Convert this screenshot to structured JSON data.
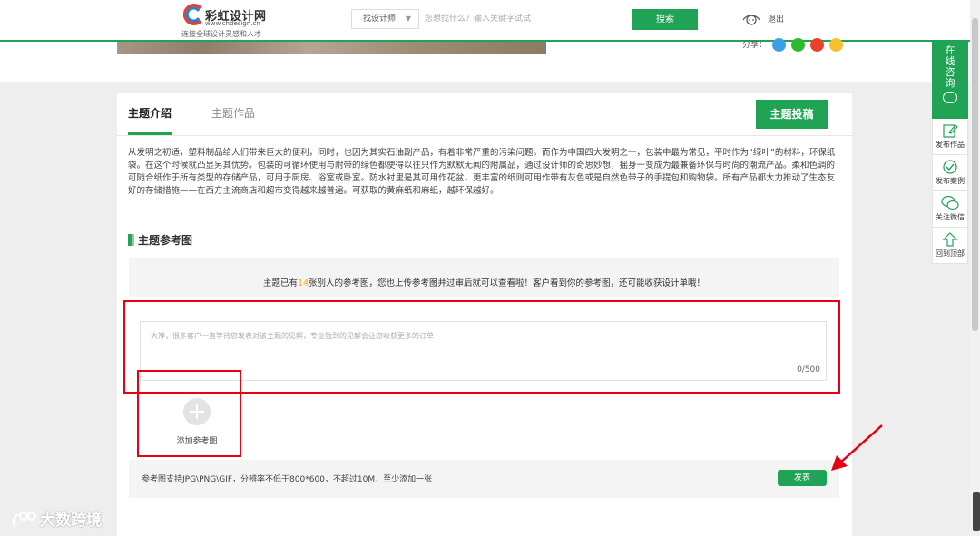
{
  "header": {
    "logo_name": "彩虹设计网",
    "logo_url": "www.chdesign.cn",
    "logo_slogan": "连接全球设计灵感和人才",
    "search_select": "找设计师",
    "search_placeholder": "您想找什么？输入关键字试试",
    "search_button": "搜索",
    "logout": "退出"
  },
  "share": {
    "label": "分享：",
    "colors": [
      "#3ba0e6",
      "#2dbb2d",
      "#e8412c",
      "#f6c02c"
    ]
  },
  "tabs": [
    {
      "label": "主题介绍",
      "active": true
    },
    {
      "label": "主题作品",
      "active": false
    }
  ],
  "submit_topic": "主题投稿",
  "intro_text": "从发明之初适，塑料制品给人们带来巨大的便利，同时，也因为其实石油副产品，有着非常严重的污染问题。而作为中国四大发明之一，包装中最为常见，平时作为“绿叶”的材料，环保纸袋。在这个时候就凸显另其优势。包装的可循环使用与附带的绿色都使得以往只作为默默无闻的附属品，通过设计师的奇思妙想，摇身一变成为最兼备环保与时尚的潮流产品。柔和色调的可随合纸作于所有类型的存储产品，可用于厨房、浴室或卧室。防水衬里是其可用作花盆，更丰富的纸则可用作带有灰色或是自然色带子的手提包和购物袋。所有产品都大力推动了生态友好的存储措施——在西方主流商店和超市变得越来越普遍。可获取的黄麻纸和麻纸，越环保越好。",
  "section_title": "主题参考图",
  "ref": {
    "notice_prefix": "主题已有",
    "notice_count": "14",
    "notice_suffix": "张别人的参考图，您也上传参考图并过审后就可以查看啦！客户看到你的参考图，还可能收获设计单哦！",
    "comment_placeholder": "大神，很多客户一直等待您发表对该主题的见解，专业独到的见解会让您收获更多的订单",
    "char_count": "0/500",
    "add_label": "添加参考图",
    "tip": "参考图支持JPG\\PNG\\GIF，分辨率不低于800*600，不超过10M，至少添加一张",
    "publish": "发表"
  },
  "float_bar": {
    "online": "在线咨询",
    "items": [
      {
        "label": "发布作品",
        "icon": "edit-icon"
      },
      {
        "label": "发布案例",
        "icon": "publish-case-icon"
      },
      {
        "label": "关注微信",
        "icon": "wechat-icon"
      },
      {
        "label": "回到顶部",
        "icon": "back-to-top-icon"
      }
    ]
  },
  "watermark": "大数跨境",
  "colors": {
    "brand_green": "#21a356",
    "annotation_red": "#e60012",
    "count_orange": "#f5a623"
  }
}
